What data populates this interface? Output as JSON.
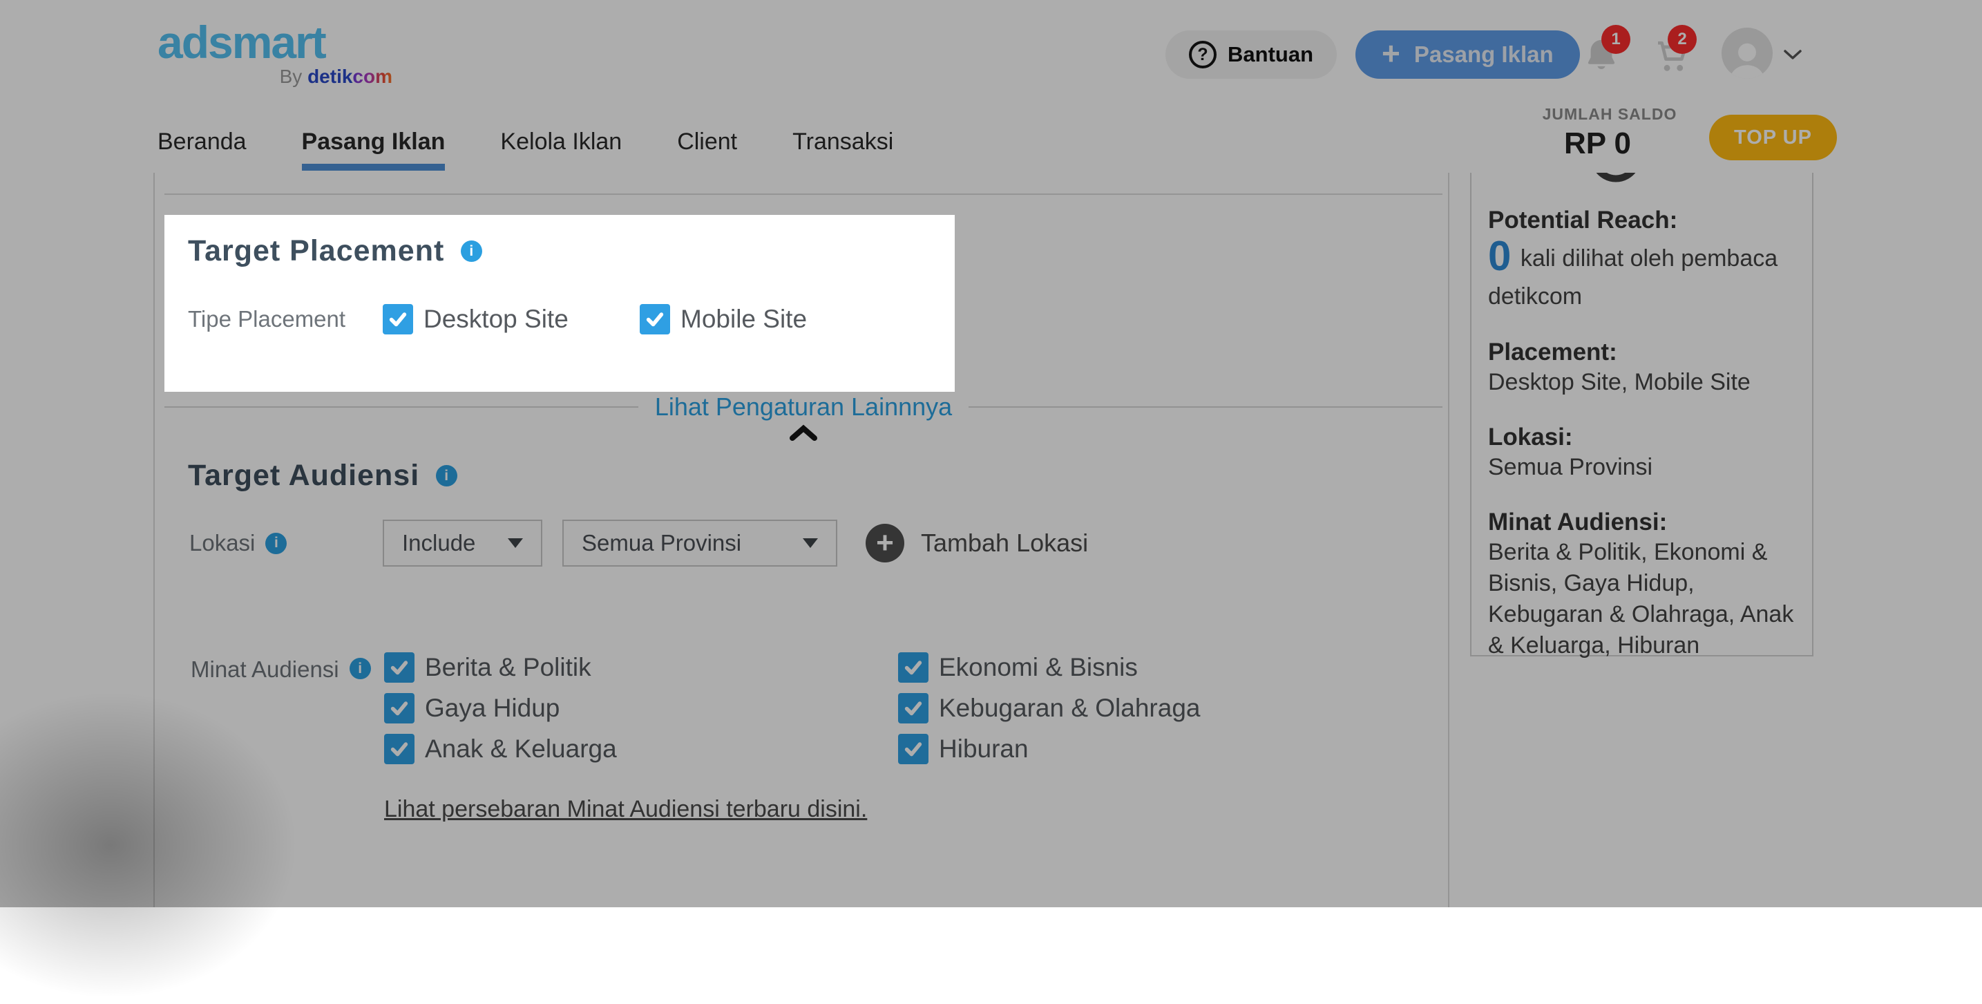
{
  "brand": {
    "name": "adsmart",
    "byline_by": "By ",
    "byline_detik": "detik",
    "byline_com": "com"
  },
  "header": {
    "help_label": "Bantuan",
    "help_icon": "?",
    "post_ad_label": "Pasang Iklan",
    "post_ad_plus": "+",
    "notification_count": "1",
    "cart_count": "2"
  },
  "nav": {
    "items": [
      {
        "label": "Beranda"
      },
      {
        "label": "Pasang Iklan"
      },
      {
        "label": "Kelola Iklan"
      },
      {
        "label": "Client"
      },
      {
        "label": "Transaksi"
      }
    ]
  },
  "balance": {
    "label": "JUMLAH SALDO",
    "amount": "RP 0",
    "topup_label": "TOP UP"
  },
  "placement": {
    "title": "Target Placement",
    "info_icon": "i",
    "row_label": "Tipe Placement",
    "options": [
      {
        "label": "Desktop Site",
        "checked": true
      },
      {
        "label": "Mobile Site",
        "checked": true
      }
    ]
  },
  "more_settings": {
    "label": "Lihat Pengaturan Lainnnya"
  },
  "audience": {
    "title": "Target Audiensi",
    "location": {
      "label": "Lokasi",
      "mode_value": "Include",
      "province_value": "Semua Provinsi",
      "add_icon": "+",
      "add_label": "Tambah Lokasi"
    },
    "interests": {
      "label": "Minat Audiensi",
      "column1": [
        "Berita & Politik",
        "Gaya Hidup",
        "Anak & Keluarga"
      ],
      "column2": [
        "Ekonomi & Bisnis",
        "Kebugaran & Olahraga",
        "Hiburan"
      ],
      "link_label": "Lihat persebaran Minat Audiensi terbaru disini."
    }
  },
  "summary": {
    "reach_label": "Potential Reach:",
    "reach_value": "0",
    "reach_text_1": " kali dilihat oleh pembaca",
    "reach_text_2": "detikcom",
    "placement_label": "Placement:",
    "placement_value": "Desktop Site, Mobile Site",
    "location_label": "Lokasi:",
    "location_value": "Semua Provinsi",
    "interests_label": "Minat Audiensi:",
    "interests_value": "Berita & Politik, Ekonomi & Bisnis, Gaya Hidup, Kebugaran & Olahraga, Anak & Keluarga, Hiburan"
  },
  "colors": {
    "accent_blue": "#2b9fe0",
    "button_blue": "#5f9ce8",
    "topup_gold": "#ffba12",
    "badge_red": "#fb2d2d",
    "heading_slate": "#3e4f5e",
    "logo_blue": "#55c0f0",
    "detik_navy": "#2a49c8",
    "overlay": "rgba(0,0,0,0.32)"
  }
}
